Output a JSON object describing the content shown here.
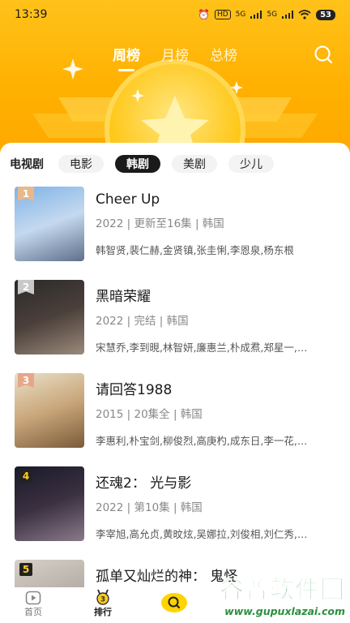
{
  "status_bar": {
    "time": "13:39",
    "net_label": "HD",
    "sig1": "5G",
    "sig2": "5G",
    "battery": "53"
  },
  "top_tabs": [
    {
      "label": "周榜",
      "active": true
    },
    {
      "label": "月榜",
      "active": false
    },
    {
      "label": "总榜",
      "active": false
    }
  ],
  "categories": [
    {
      "label": "电视剧",
      "active": false
    },
    {
      "label": "电影",
      "active": false
    },
    {
      "label": "韩剧",
      "active": true
    },
    {
      "label": "美剧",
      "active": false
    },
    {
      "label": "少儿",
      "active": false
    }
  ],
  "shows": [
    {
      "rank": "1",
      "title": "Cheer Up",
      "meta": "2022 | 更新至16集 | 韩国",
      "cast": "韩智贤,裴仁赫,金贤镇,张圭悧,李恩泉,杨东根",
      "rank_color": "#e8b88a",
      "poster_colors": [
        "#7fb2e6",
        "#c4d9ef",
        "#5f6f8a"
      ]
    },
    {
      "rank": "2",
      "title": "黑暗荣耀",
      "meta": "2022 | 完结 | 韩国",
      "cast": "宋慧乔,李到晛,林智妍,廉惠兰,朴成焄,郑星一,…",
      "rank_color": "#c9c9c9",
      "poster_colors": [
        "#2a2a2a",
        "#4b3f3a",
        "#9a8a7a"
      ]
    },
    {
      "rank": "3",
      "title": "请回答1988",
      "meta": "2015 | 20集全 | 韩国",
      "cast": "李惠利,朴宝剑,柳俊烈,高庚杓,成东日,李一花,…",
      "rank_color": "#e7a58a",
      "poster_colors": [
        "#e9e0c8",
        "#c9a67a",
        "#7a5a3a"
      ]
    },
    {
      "rank": "4",
      "title": "还魂2： 光与影",
      "meta": "2022 | 第10集 | 韩国",
      "cast": "李宰旭,高允贞,黄旼炫,吴娜拉,刘俊相,刘仁秀,…",
      "rank_color": "#222222",
      "poster_colors": [
        "#1a1a2a",
        "#3a3040",
        "#8a7a8a"
      ]
    },
    {
      "rank": "5",
      "title": "孤单又灿烂的神： 鬼怪",
      "meta": "",
      "cast": "",
      "rank_color": "#222222",
      "poster_colors": [
        "#d6d0c8",
        "#b8b0a8",
        "#6a6058"
      ]
    }
  ],
  "bottom_nav": [
    {
      "label": "首页",
      "icon": "play-square-icon",
      "active": false
    },
    {
      "label": "排行",
      "icon": "ranking-medal-icon",
      "active": true
    },
    {
      "label": "",
      "icon": "search-icon",
      "active": false
    }
  ],
  "watermark": {
    "main": "谷普软件园",
    "url": "www.gupuxlazai.com"
  },
  "colors": {
    "accent": "#ffb000",
    "active_chip": "#1a1a1a",
    "watermark_green": "#2a8f3d"
  }
}
